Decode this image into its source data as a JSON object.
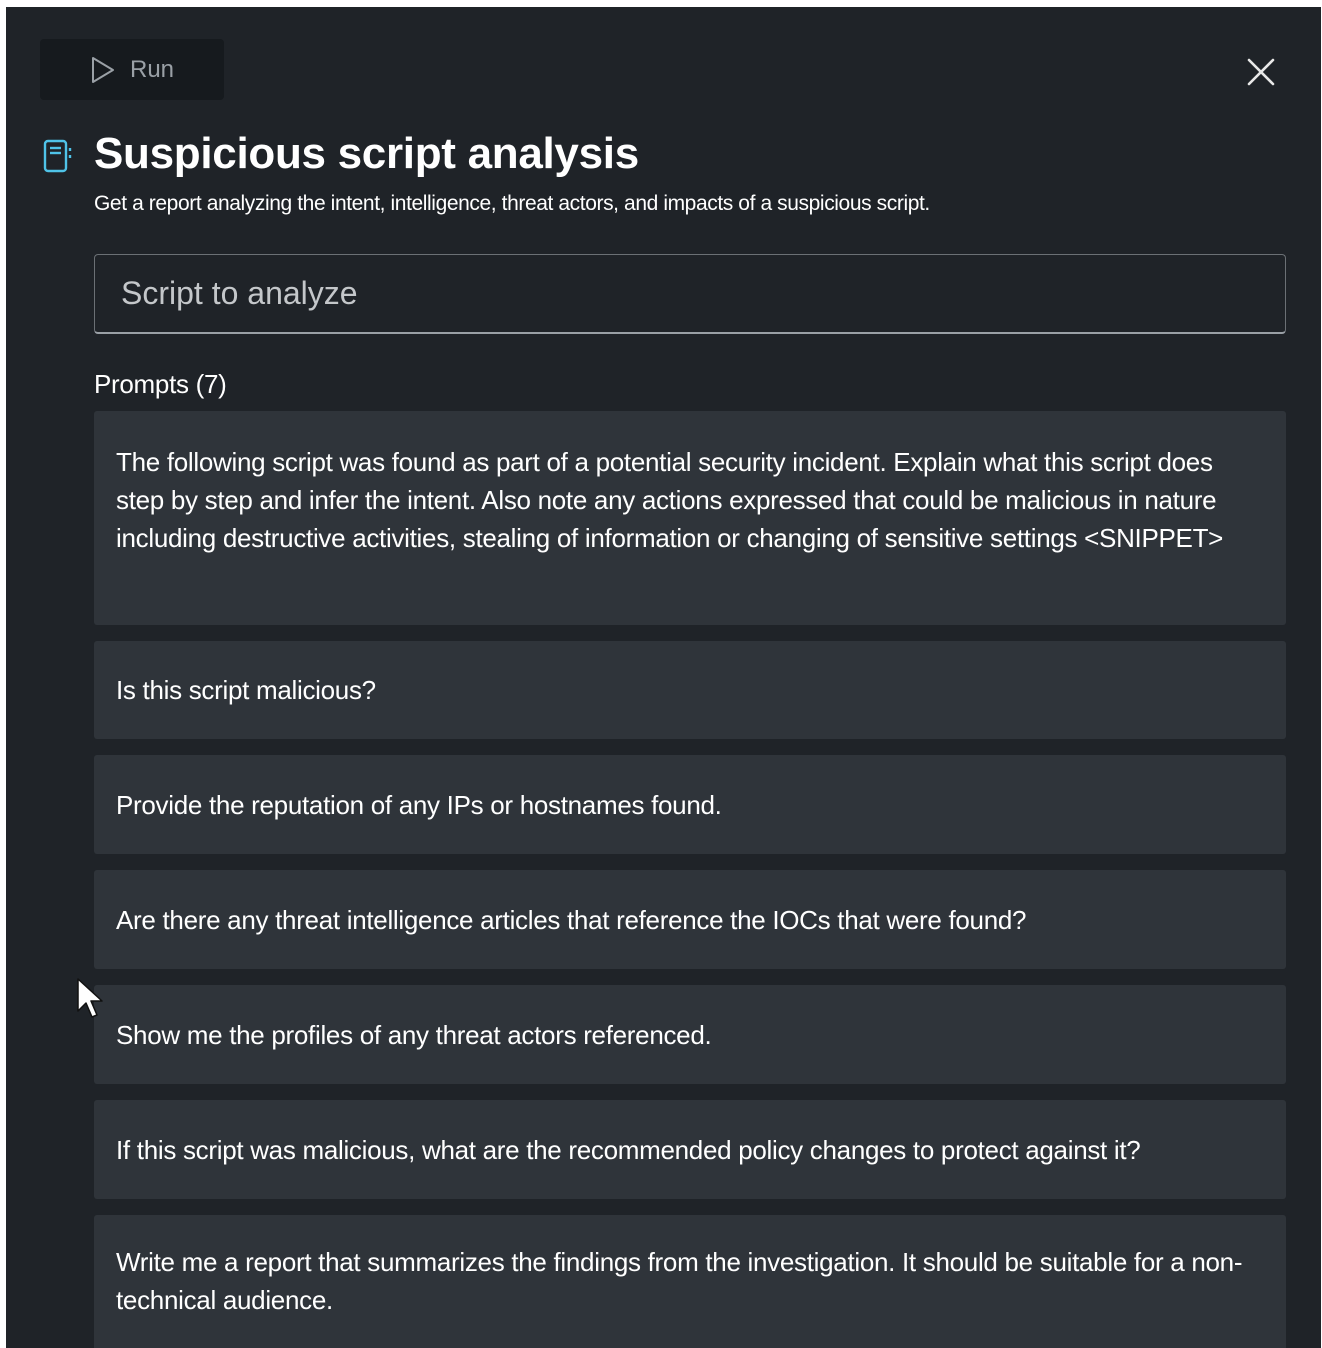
{
  "toolbar": {
    "run_label": "Run",
    "run_icon": "play-icon",
    "close_icon": "close-icon"
  },
  "header": {
    "icon": "notebook-icon",
    "title": "Suspicious script analysis",
    "subtitle": "Get a report analyzing the intent, intelligence, threat actors, and impacts of a suspicious script."
  },
  "input": {
    "placeholder": "Script to analyze",
    "value": ""
  },
  "prompts": {
    "heading": "Prompts (7)",
    "items": [
      "The following script was found as part of a potential security incident. Explain what this script does step by step and infer the intent. Also note any actions expressed that could be malicious in nature including destructive activities, stealing of information or changing of sensitive settings <SNIPPET>",
      "Is this script malicious?",
      "Provide the reputation of any IPs or hostnames found.",
      "Are there any threat intelligence articles that reference the IOCs that were found?",
      "Show me the profiles of any threat actors referenced.",
      "If this script was malicious, what are the recommended policy changes to protect against it?",
      "Write me a report that summarizes the findings from the investigation. It should be suitable for a non-technical audience."
    ]
  },
  "colors": {
    "background": "#1f2328",
    "card": "#2f343a",
    "run_button": "#161a1e",
    "accent_icon": "#4fc3e8"
  }
}
